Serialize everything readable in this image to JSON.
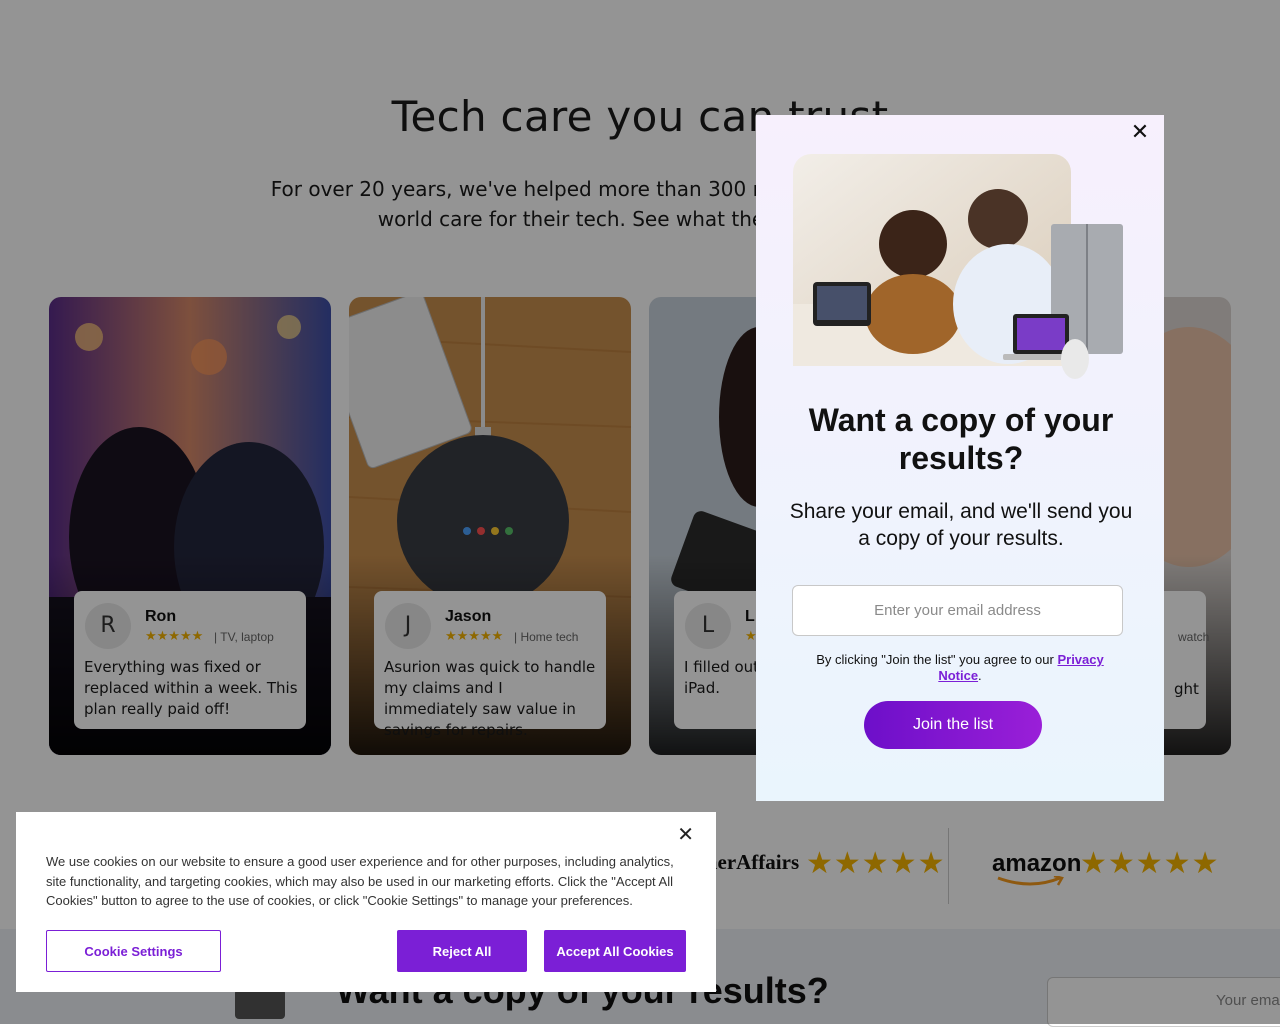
{
  "hero": {
    "title": "Tech care you can trust",
    "subtitle": "For over 20 years, we've helped more than 300 million people around the world care for their tech. See what they have to say."
  },
  "reviews": [
    {
      "initial": "R",
      "name": "Ron",
      "stars": "★★★★★",
      "meta": "TV, laptop",
      "text": "Everything was fixed or replaced within a week. This plan really paid off!"
    },
    {
      "initial": "J",
      "name": "Jason",
      "stars": "★★★★★",
      "meta": "Home tech",
      "text": "Asurion was quick to handle my claims and I immediately saw value in savings for repairs."
    },
    {
      "initial": "L",
      "name": "L",
      "stars": "★★★★★",
      "meta": "",
      "text": "I filled out literally the new iPad."
    },
    {
      "initial": "",
      "name": "",
      "stars": "",
      "meta": "watch",
      "text": "ght"
    }
  ],
  "ratings": [
    {
      "brand": "merAffairs",
      "stars": "★★★★★",
      "value": 4.5
    },
    {
      "brand": "amazon",
      "stars": "★★★★★",
      "value": 4.5
    }
  ],
  "bottom": {
    "title": "Want a copy of your results?",
    "input_placeholder": "Your email"
  },
  "modal": {
    "title": "Want a copy of your results?",
    "subtitle": "Share your email, and we'll send you a copy of your results.",
    "email_placeholder": "Enter your email address",
    "legal_prefix": "By clicking \"Join the list\" you agree to our",
    "legal_link": "Privacy Notice",
    "legal_suffix": ".",
    "button": "Join the list",
    "close": "✕"
  },
  "cookie": {
    "text": "We use cookies on our website to ensure a good user experience and for other purposes, including analytics, site functionality, and targeting cookies, which may also be used in our marketing efforts. Click the \"Accept All Cookies\" button to agree to the use of cookies, or click \"Cookie Settings\" to manage your preferences.",
    "settings_label": "Cookie Settings",
    "reject_label": "Reject All",
    "accept_label": "Accept All Cookies",
    "close": "✕"
  },
  "colors": {
    "brand_purple": "#7b1fd6",
    "star_gold": "#f5b301"
  }
}
